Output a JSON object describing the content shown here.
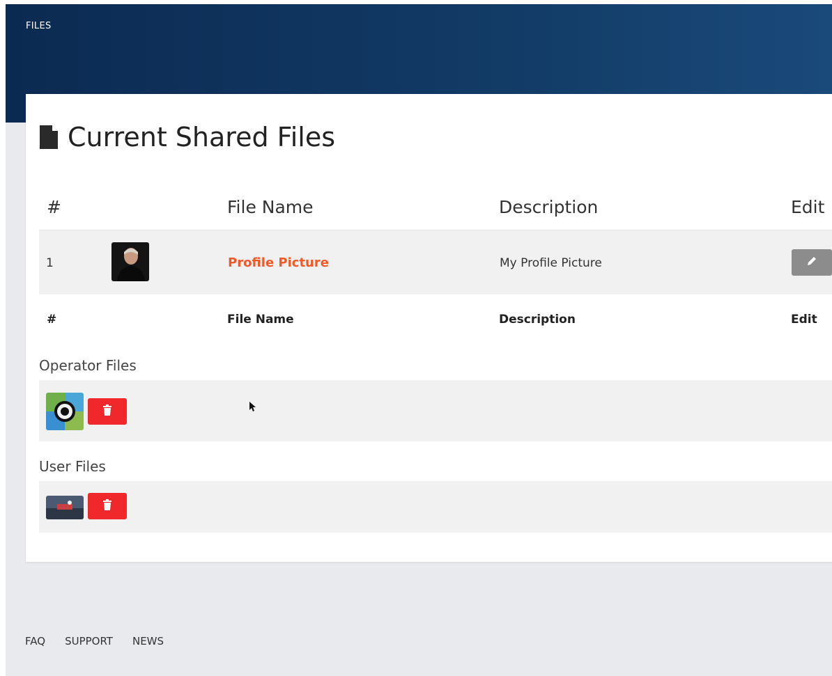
{
  "header": {
    "title": "FILES"
  },
  "card": {
    "title": "Current Shared Files",
    "title_icon": "file-icon",
    "columns": {
      "num": "#",
      "file_name": "File Name",
      "description": "Description",
      "edit": "Edit"
    },
    "rows": [
      {
        "num": "1",
        "file_name": "Profile Picture",
        "description": "My Profile Picture",
        "thumb": "profile-photo",
        "edit_icon": "pencil-icon"
      }
    ],
    "footer_columns": {
      "num": "#",
      "file_name": "File Name",
      "description": "Description",
      "edit": "Edit"
    },
    "operator_section": {
      "label": "Operator Files",
      "delete_icon": "trash-icon"
    },
    "user_section": {
      "label": "User Files",
      "delete_icon": "trash-icon"
    }
  },
  "footer": {
    "links": [
      "FAQ",
      "SUPPORT",
      "NEWS"
    ]
  },
  "colors": {
    "accent": "#f05a28",
    "delete": "#f0272b",
    "header": "#0b2a52",
    "edit": "#8c8c8c"
  }
}
